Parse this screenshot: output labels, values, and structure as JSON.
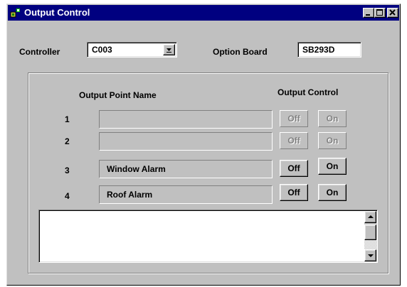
{
  "window": {
    "title": "Output Control",
    "controls": {
      "minimize": "_",
      "maximize": "□",
      "close": "×"
    }
  },
  "header": {
    "controller_label": "Controller",
    "controller_value": "C003",
    "option_board_label": "Option Board",
    "option_board_value": "SB293D"
  },
  "outputs": {
    "name_header": "Output Point Name",
    "control_header": "Output Control",
    "rows": [
      {
        "num": "1",
        "name": "",
        "off": "Off",
        "on": "On",
        "enabled": false
      },
      {
        "num": "2",
        "name": "",
        "off": "Off",
        "on": "On",
        "enabled": false
      },
      {
        "num": "3",
        "name": "Window Alarm",
        "off": "Off",
        "on": "On",
        "enabled": true
      },
      {
        "num": "4",
        "name": "Roof Alarm",
        "off": "Off",
        "on": "On",
        "enabled": true
      }
    ]
  },
  "log": {
    "text": ""
  },
  "icons": {
    "app": "app-icon",
    "dropdown": "chevron-down-icon",
    "scroll_up": "arrow-up-icon",
    "scroll_down": "arrow-down-icon"
  },
  "colors": {
    "titlebar": "#000080",
    "face": "#c0c0c0",
    "disabled_text": "#808080"
  }
}
